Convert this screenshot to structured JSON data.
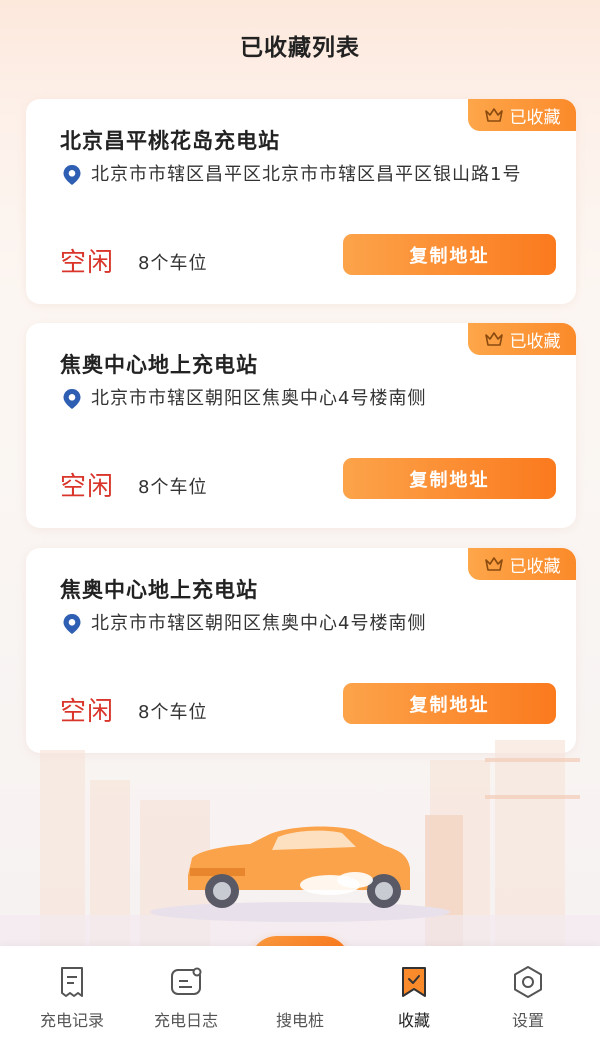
{
  "header": {
    "title": "已收藏列表"
  },
  "cards": [
    {
      "name": "北京昌平桃花岛充电站",
      "address": "北京市市辖区昌平区北京市市辖区昌平区银山路1号",
      "status": "空闲",
      "spots": "8个车位",
      "badge": "已收藏",
      "button": "复制地址"
    },
    {
      "name": "焦奥中心地上充电站",
      "address": "北京市市辖区朝阳区焦奥中心4号楼南侧",
      "status": "空闲",
      "spots": "8个车位",
      "badge": "已收藏",
      "button": "复制地址"
    },
    {
      "name": "焦奥中心地上充电站",
      "address": "北京市市辖区朝阳区焦奥中心4号楼南侧",
      "status": "空闲",
      "spots": "8个车位",
      "badge": "已收藏",
      "button": "复制地址"
    }
  ],
  "tabbar": {
    "items": [
      {
        "label": "充电记录",
        "icon": "receipt-icon"
      },
      {
        "label": "充电日志",
        "icon": "log-icon"
      },
      {
        "label": "搜电桩",
        "icon": "lightning-icon"
      },
      {
        "label": "收藏",
        "icon": "bookmark-icon"
      },
      {
        "label": "设置",
        "icon": "settings-icon"
      }
    ],
    "active": "收藏"
  },
  "colors": {
    "accent": "#fb7a1e",
    "status": "#d9352a",
    "pin": "#2f5fb3"
  }
}
